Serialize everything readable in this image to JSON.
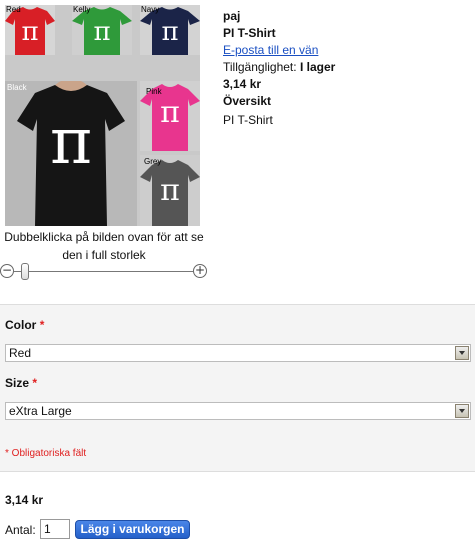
{
  "gallery": {
    "tiles": [
      {
        "label": "Red",
        "color": "#d81f26"
      },
      {
        "label": "Kelly",
        "color": "#2f9a3a"
      },
      {
        "label": "Navy",
        "color": "#1b2448"
      },
      {
        "label": "Black",
        "color": "#151515"
      },
      {
        "label": "Pink",
        "color": "#e8358e"
      },
      {
        "label": "Grey",
        "color": "#555555"
      }
    ],
    "pi_symbol": "π",
    "caption": "Dubbelklicka på bilden ovan för att se den i full storlek",
    "zoom_minus": "−",
    "zoom_plus": "+"
  },
  "product": {
    "brand": "paj",
    "name": "PI T-Shirt",
    "email_link": "E-posta till en vän",
    "availability_label": "Tillgänglighet:",
    "availability_value": "I lager",
    "price": "3,14 kr",
    "overview_heading": "Översikt",
    "overview_text": "PI T-Shirt"
  },
  "options": {
    "color_label": "Color",
    "color_value": "Red",
    "size_label": "Size",
    "size_value": "eXtra Large",
    "required_marker": "*",
    "required_note": "* Obligatoriska fält"
  },
  "cart": {
    "price": "3,14 kr",
    "qty_label": "Antal:",
    "qty_value": "1",
    "add_button": "Lägg i varukorgen"
  }
}
